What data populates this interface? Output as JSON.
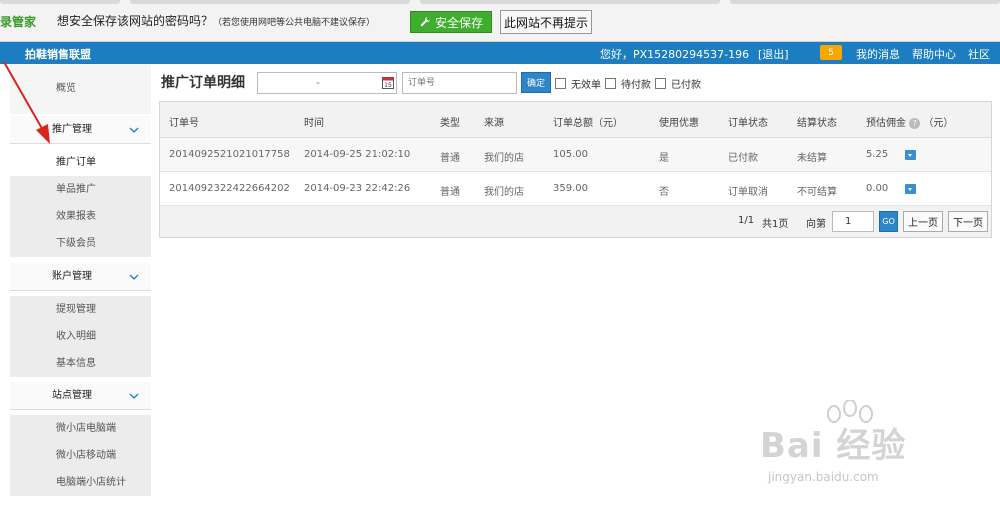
{
  "colors": {
    "header_bg": "#1c7ec0",
    "accent_green": "#3fae2f",
    "accent_blue": "#2e86c9",
    "badge": "#f6a800",
    "annotation": "#d9261c"
  },
  "password_bar": {
    "brand": "登录管家",
    "question": "想安全保存该网站的密码吗？",
    "hint": "（若您使用网吧等公共电脑不建议保存）",
    "save_button": "安全保存",
    "never_button": "此网站不再提示"
  },
  "header": {
    "title": "拍鞋销售联盟",
    "greeting": "您好，PX15280294537-196",
    "logout": "[退出]",
    "badge": "5",
    "messages": "我的消息",
    "help": "帮助中心",
    "community": "社区"
  },
  "sidebar": {
    "overview": "概览",
    "groups": [
      {
        "label": "推广管理",
        "items": [
          "推广订单",
          "单品推广",
          "效果报表",
          "下级会员"
        ]
      },
      {
        "label": "账户管理",
        "items": [
          "提现管理",
          "收入明细",
          "基本信息"
        ]
      },
      {
        "label": "站点管理",
        "items": [
          "微小店电脑端",
          "微小店移动端",
          "电脑端小店统计"
        ]
      }
    ]
  },
  "main": {
    "title": "推广订单明细",
    "date_separator": "-",
    "order_placeholder": "订单号",
    "confirm_button": "确定",
    "filters": [
      "无效单",
      "待付款",
      "已付款"
    ],
    "table": {
      "headers": [
        "订单号",
        "时间",
        "类型",
        "来源",
        "订单总额（元）",
        "使用优惠",
        "订单状态",
        "结算状态",
        "预估佣金",
        "（元）"
      ],
      "rows": [
        [
          "2014092521021017758",
          "2014-09-25 21:02:10",
          "普通",
          "我们的店",
          "105.00",
          "是",
          "已付款",
          "未结算",
          "5.25"
        ],
        [
          "2014092322422664202",
          "2014-09-23 22:42:26",
          "普通",
          "我们的店",
          "359.00",
          "否",
          "订单取消",
          "不可结算",
          "0.00"
        ]
      ]
    },
    "pager": {
      "page_info": "1/1",
      "total": "共1页",
      "goto_label": "向第",
      "goto_value": "1",
      "go_button": "GO",
      "prev": "上一页",
      "next": "下一页"
    }
  },
  "watermark": {
    "brand": "Bai 经验",
    "url": "jingyan.baidu.com"
  }
}
